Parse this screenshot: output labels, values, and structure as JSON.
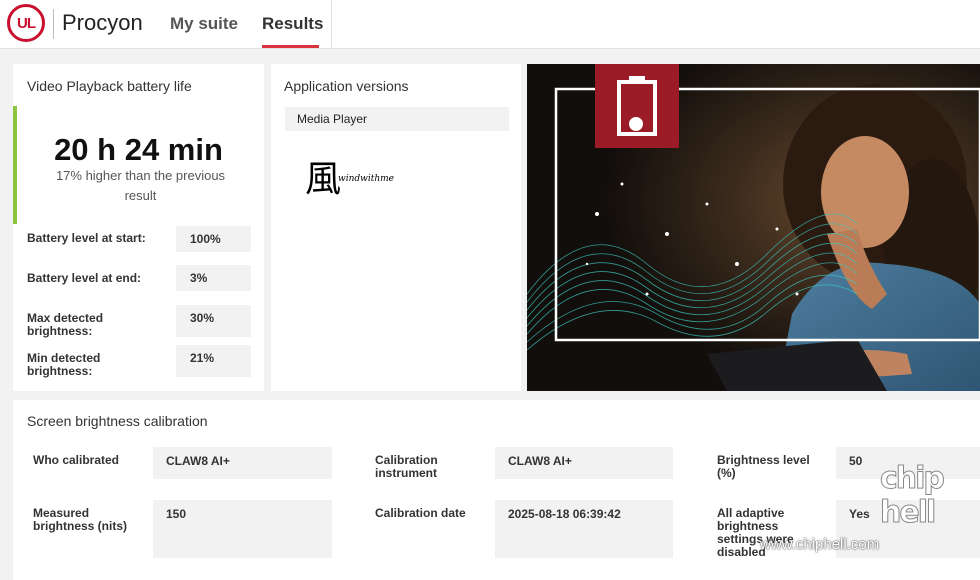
{
  "header": {
    "logo_text": "UL",
    "brand": "Procyon",
    "nav": [
      {
        "label": "My suite",
        "active": false
      },
      {
        "label": "Results",
        "active": true
      }
    ]
  },
  "battery": {
    "title": "Video Playback battery life",
    "value": "20 h 24 min",
    "comparison": "17% higher than the previous result",
    "rows": [
      {
        "label": "Battery level at start:",
        "value": "100%"
      },
      {
        "label": "Battery level at end:",
        "value": "3%"
      },
      {
        "label": "Max detected brightness:",
        "value": "30%"
      },
      {
        "label": "Min detected brightness:",
        "value": "21%"
      }
    ]
  },
  "app_versions": {
    "title": "Application versions",
    "items": [
      "Media Player"
    ],
    "signature_glyph": "風",
    "signature_text": "windwithme"
  },
  "calibration": {
    "title": "Screen brightness calibration",
    "who_label": "Who calibrated",
    "who_value": "CLAW8 AI+",
    "instrument_label": "Calibration instrument",
    "instrument_value": "CLAW8 AI+",
    "level_label": "Brightness level (%)",
    "level_value": "50",
    "measured_label": "Measured brightness (nits)",
    "measured_value": "150",
    "date_label": "Calibration date",
    "date_value": "2025-08-18 06:39:42",
    "adaptive_label": "All adaptive brightness settings were disabled",
    "adaptive_value": "Yes"
  },
  "watermark": {
    "site": "www.chiphell.com",
    "logo": "chip hell"
  },
  "colors": {
    "accent_red": "#c8102e",
    "success_green": "#8cc63f",
    "tile_red": "#9b1c26"
  }
}
